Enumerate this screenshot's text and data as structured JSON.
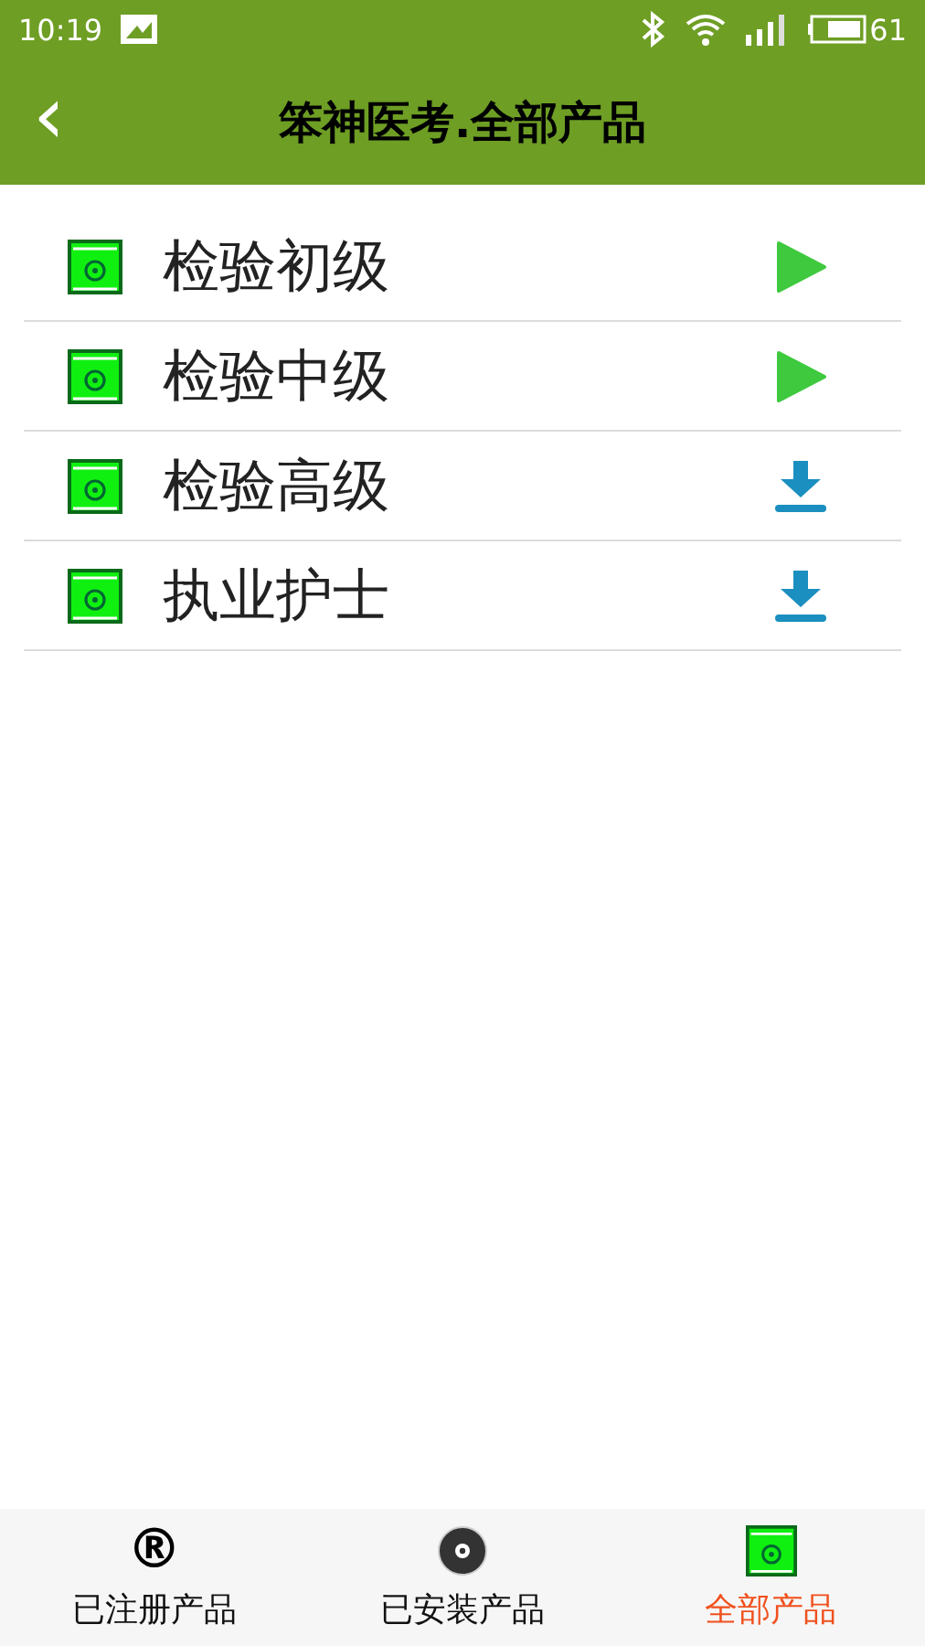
{
  "status_bar": {
    "time": "10:19",
    "battery": "61"
  },
  "header": {
    "back": "‹",
    "title": "笨神医考.全部产品"
  },
  "products": [
    {
      "name": "检验初级",
      "kind": "play"
    },
    {
      "name": "检验中级",
      "kind": "play"
    },
    {
      "name": "检验高级",
      "kind": "download"
    },
    {
      "name": "执业护士",
      "kind": "download"
    }
  ],
  "tabs": [
    {
      "label": "已注册产品",
      "kind": "registered",
      "glyph": "®",
      "selected": false
    },
    {
      "label": "已安装产品",
      "kind": "installed",
      "selected": false
    },
    {
      "label": "全部产品",
      "kind": "all",
      "selected": true
    }
  ]
}
